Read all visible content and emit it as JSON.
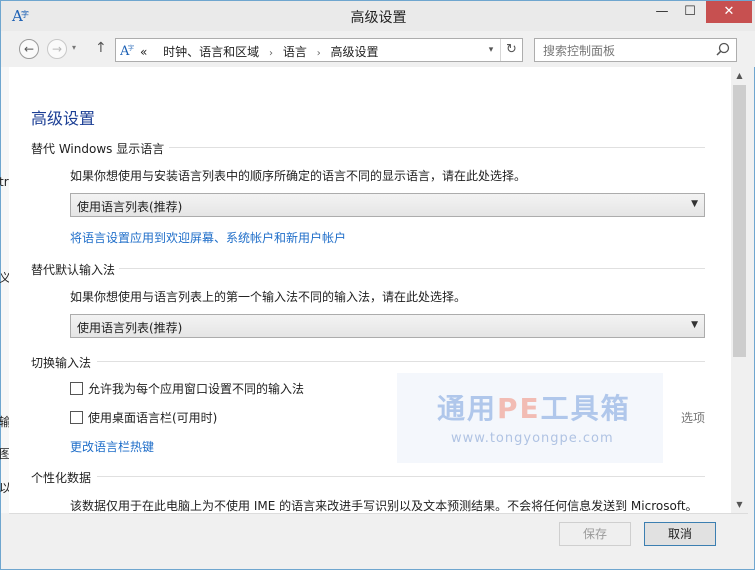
{
  "window": {
    "title": "高级设置",
    "min_label": "—",
    "max_label": "☐",
    "close_label": "✕"
  },
  "nav": {
    "back_label": "←",
    "forward_label": "→",
    "history_label": "▾",
    "up_label": "↑",
    "address": {
      "prefix": "«",
      "crumbs": [
        "时钟、语言和区域",
        "语言",
        "高级设置"
      ],
      "sep": "›",
      "dropdown_label": "▾",
      "refresh_label": "↻"
    },
    "search": {
      "placeholder": "搜索控制面板"
    }
  },
  "content": {
    "page_title": "高级设置",
    "display_language": {
      "title": "替代 Windows 显示语言",
      "desc": "如果你想使用与安装语言列表中的顺序所确定的语言不同的显示语言，请在此处选择。",
      "select_value": "使用语言列表(推荐)",
      "link": "将语言设置应用到欢迎屏幕、系统帐户和新用户帐户"
    },
    "default_input": {
      "title": "替代默认输入法",
      "desc": "如果你想使用与语言列表上的第一个输入法不同的输入法，请在此处选择。",
      "select_value": "使用语言列表(推荐)"
    },
    "switch_input": {
      "title": "切换输入法",
      "checkbox1": "允许我为每个应用窗口设置不同的输入法",
      "checkbox2": "使用桌面语言栏(可用时)",
      "options_link": "选项",
      "hotkey_link": "更改语言栏热键"
    },
    "personalization": {
      "title": "个性化数据",
      "desc": "该数据仅用于在此电脑上为不使用 IME 的语言来改进手写识别以及文本预测结果。不会将任何信息发送到 Microsoft。"
    },
    "watermark": {
      "big_a": "通用",
      "big_pe": "PE",
      "big_b": "工具箱",
      "small": "www.tongyongpe.com"
    }
  },
  "footer": {
    "save_label": "保存",
    "cancel_label": "取消"
  },
  "background_glyphs": [
    "tr",
    "义",
    "输",
    "图",
    "以"
  ],
  "scrollbar": {
    "up_label": "▲",
    "down_label": "▼"
  },
  "colors": {
    "accent": "#1f6ec9",
    "title_blue": "#1c3f95",
    "close_red": "#c75050"
  }
}
